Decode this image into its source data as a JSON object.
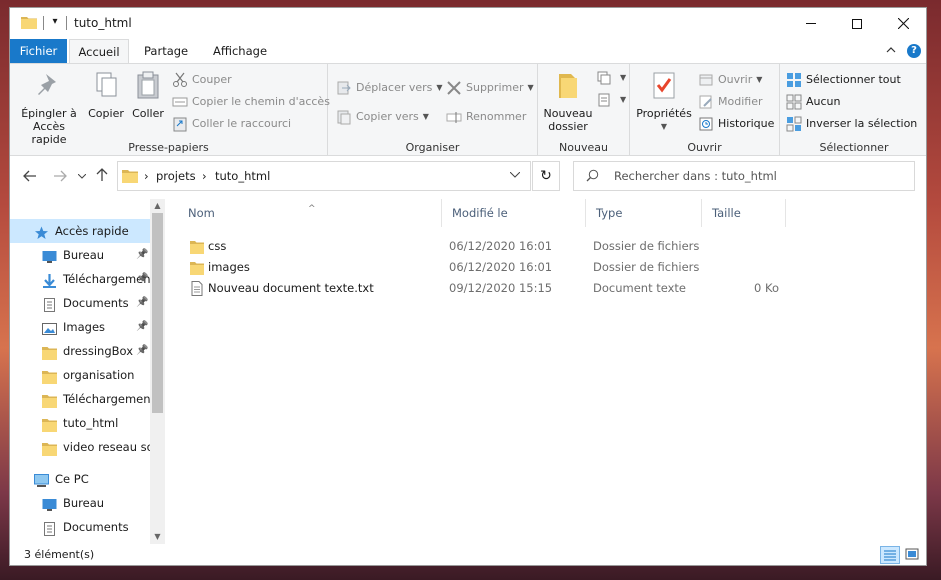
{
  "window": {
    "title": "tuto_html",
    "qat_glyph": "▾"
  },
  "tabs": {
    "file": "Fichier",
    "home": "Accueil",
    "share": "Partage",
    "view": "Affichage",
    "help": "?"
  },
  "ribbon": {
    "clipboard": {
      "label": "Presse-papiers",
      "pin": "Épingler à\nAccès rapide",
      "copy": "Copier",
      "paste": "Coller",
      "cut": "Couper",
      "copy_path": "Copier le chemin d'accès",
      "paste_shortcut": "Coller le raccourci"
    },
    "organize": {
      "label": "Organiser",
      "move_to": "Déplacer vers",
      "copy_to": "Copier vers",
      "delete": "Supprimer",
      "rename": "Renommer"
    },
    "new": {
      "label": "Nouveau",
      "new_folder": "Nouveau\ndossier"
    },
    "open": {
      "label": "Ouvrir",
      "properties": "Propriétés",
      "open": "Ouvrir",
      "edit": "Modifier",
      "history": "Historique"
    },
    "select": {
      "label": "Sélectionner",
      "select_all": "Sélectionner tout",
      "select_none": "Aucun",
      "invert": "Inverser la sélection"
    }
  },
  "address": {
    "crumbs": [
      "projets",
      "tuto_html"
    ],
    "search_placeholder": "Rechercher dans : tuto_html"
  },
  "navpane": {
    "items": [
      {
        "label": "Accès rapide",
        "icon": "star-icon",
        "pinned": false,
        "selected": true
      },
      {
        "label": "Bureau",
        "icon": "desktop-icon",
        "pinned": true
      },
      {
        "label": "Téléchargements",
        "icon": "download-icon",
        "pinned": true
      },
      {
        "label": "Documents",
        "icon": "document-icon",
        "pinned": true
      },
      {
        "label": "Images",
        "icon": "pictures-icon",
        "pinned": true
      },
      {
        "label": "dressingBox",
        "icon": "folder-icon",
        "pinned": true
      },
      {
        "label": "organisation",
        "icon": "folder-icon",
        "pinned": false
      },
      {
        "label": "Téléchargements",
        "icon": "folder-icon",
        "pinned": false
      },
      {
        "label": "tuto_html",
        "icon": "folder-icon",
        "pinned": false
      },
      {
        "label": "video reseau social",
        "icon": "folder-icon",
        "pinned": false
      },
      {
        "label": "Ce PC",
        "icon": "computer-icon",
        "pinned": false
      },
      {
        "label": "Bureau",
        "icon": "desktop-icon",
        "pinned": false
      },
      {
        "label": "Documents",
        "icon": "document-icon",
        "pinned": false
      }
    ]
  },
  "columns": {
    "name": "Nom",
    "modified": "Modifié le",
    "type": "Type",
    "size": "Taille"
  },
  "files": [
    {
      "name": "css",
      "modified": "06/12/2020 16:01",
      "type": "Dossier de fichiers",
      "size": "",
      "icon": "folder-icon"
    },
    {
      "name": "images",
      "modified": "06/12/2020 16:01",
      "type": "Dossier de fichiers",
      "size": "",
      "icon": "folder-icon"
    },
    {
      "name": "Nouveau document texte.txt",
      "modified": "09/12/2020 15:15",
      "type": "Document texte",
      "size": "0 Ko",
      "icon": "text-file-icon"
    }
  ],
  "status": {
    "count": "3 élément(s)"
  },
  "colors": {
    "accent": "#1979ca",
    "folder": "#f8d775",
    "selection": "#cce8ff"
  }
}
